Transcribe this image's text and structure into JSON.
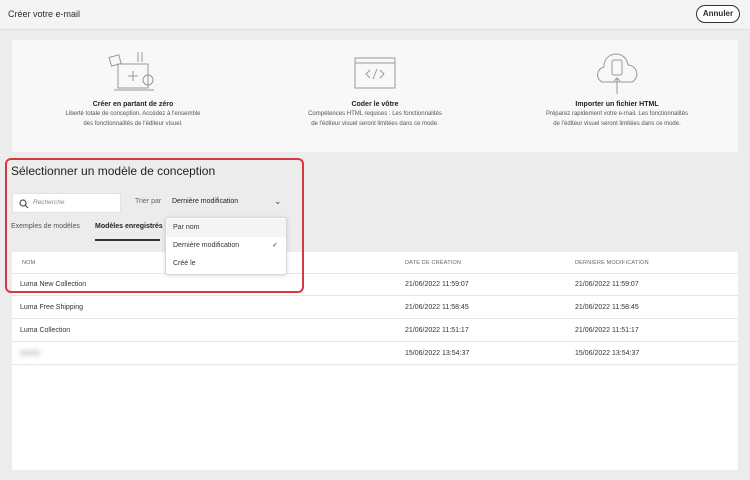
{
  "header": {
    "title": "Créer votre e-mail",
    "cancel_label": "Annuler"
  },
  "options": [
    {
      "title": "Créer en partant de zéro",
      "line1": "Liberté totale de conception. Accédez à l'ensemble",
      "line2": "des fonctionnalités de l'éditeur visuel."
    },
    {
      "title": "Coder le vôtre",
      "line1": "Compétences HTML requises : Les fonctionnalités",
      "line2": "de l'éditeur visuel seront limitées dans ce mode."
    },
    {
      "title": "Importer un fichier HTML",
      "line1": "Préparez rapidement votre e-mail. Les fonctionnalités",
      "line2": "de l'éditeur visuel seront limitées dans ce mode."
    }
  ],
  "section": {
    "title": "Sélectionner un modèle de conception",
    "search_placeholder": "Recherche",
    "sort_label": "Trier par",
    "sort_value": "Dernière modification"
  },
  "tabs": [
    {
      "label": "Exemples de modèles"
    },
    {
      "label": "Modèles enregistrés",
      "active": true
    }
  ],
  "dropdown": {
    "items": [
      {
        "label": "Par nom"
      },
      {
        "label": "Dernière modification",
        "selected": true
      },
      {
        "label": "Créé le"
      }
    ]
  },
  "table": {
    "headers": [
      "NOM",
      "DATE DE CRÉATION",
      "DERNIÈRE MODIFICATION"
    ],
    "rows": [
      {
        "name": "Luma New Collection",
        "created": "21/06/2022 11:59:07",
        "modified": "21/06/2022 11:59:07"
      },
      {
        "name": "Luma Free Shipping",
        "created": "21/06/2022 11:58:45",
        "modified": "21/06/2022 11:58:45"
      },
      {
        "name": "Luma Collection",
        "created": "21/06/2022 11:51:17",
        "modified": "21/06/2022 11:51:17"
      },
      {
        "name": "",
        "created": "15/06/2022 13:54:37",
        "modified": "15/06/2022 13:54:37"
      }
    ]
  },
  "colors": {
    "highlight": "#d7373f"
  }
}
